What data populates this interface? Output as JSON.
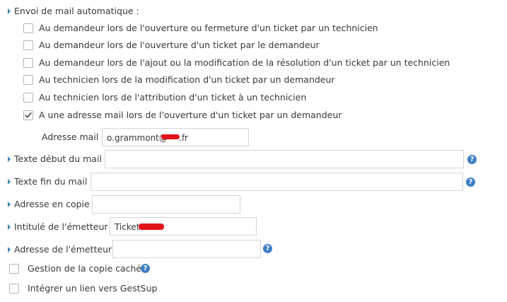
{
  "mail_auto": {
    "title": "Envoi de mail automatique :",
    "options": [
      {
        "label": "Au demandeur lors de l'ouverture ou fermeture d'un ticket par un technicien",
        "checked": false
      },
      {
        "label": "Au demandeur lors de l'ouverture d'un ticket par le demandeur",
        "checked": false
      },
      {
        "label": "Au demandeur lors de l'ajout ou la modification de la résolution d'un ticket par un technicien",
        "checked": false
      },
      {
        "label": "Au technicien lors de la modification d'un ticket par un demandeur",
        "checked": false
      },
      {
        "label": "Au technicien lors de l'attribution d'un ticket à un technicien",
        "checked": false
      },
      {
        "label": "A une adresse mail lors de l'ouverture d'un ticket par un demandeur",
        "checked": true
      }
    ],
    "address_label": "Adresse mail :",
    "address_value": "o.grammont@",
    "address_suffix": ".fr"
  },
  "fields": {
    "debut_label": "Texte début du mail :",
    "debut_value": "",
    "fin_label": "Texte fin du mail :",
    "fin_value": "",
    "copie_label": "Adresse en copie :",
    "copie_value": "",
    "intitule_label": "Intitulé de l'émetteur :",
    "intitule_value": "Ticket",
    "emetteur_label": "Adresse de l'émetteur :",
    "emetteur_value": ""
  },
  "bottom": {
    "cache_label": "Gestion de la copie cachée",
    "cache_checked": false,
    "gestsup_label": "Intégrer un lien vers GestSup",
    "gestsup_checked": false
  },
  "colors": {
    "caret": "#3a87ad",
    "help": "#3e7fc4",
    "check": "#3a3a3a",
    "redaction": "#e2141b"
  },
  "help_glyph": "?",
  "icons": {
    "help": "question-circle-icon",
    "caret": "caret-right-icon",
    "check": "checkmark-icon"
  }
}
